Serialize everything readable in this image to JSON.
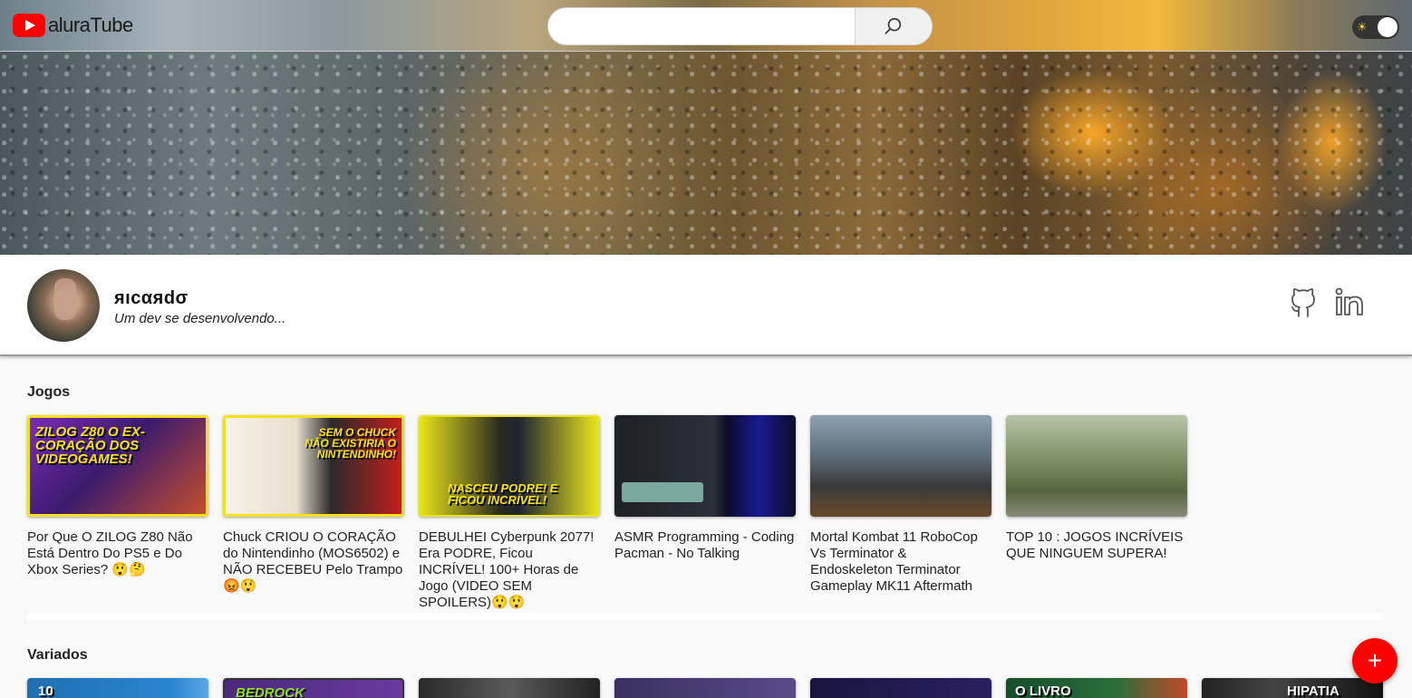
{
  "header": {
    "logo_text": "aluraTube",
    "search_placeholder": "",
    "search_value": ""
  },
  "profile": {
    "name": "яıcαяdσ",
    "bio": "Um dev se desenvolvendo..."
  },
  "sections": [
    {
      "title": "Jogos",
      "videos": [
        {
          "title": "Por Que O ZILOG Z80 Não Está Dentro Do PS5 e Do Xbox Series? 😲🤔",
          "thumb_text": "ZILOG Z80 O EX-CORAÇÃO DOS VIDEOGAMES!"
        },
        {
          "title": "Chuck CRIOU O CORAÇÃO do Nintendinho (MOS6502) e NÃO RECEBEU Pelo Trampo 😡😲",
          "thumb_text": "SEM O CHUCK NÃO EXISTIRIA O NINTENDINHO!"
        },
        {
          "title": "DEBULHEI Cyberpunk 2077! Era PODRE, Ficou INCRÍVEL! 100+ Horas de Jogo (VIDEO SEM SPOILERS)😲😲",
          "thumb_text": "NASCEU PODRE! E FICOU INCRÍVEL!"
        },
        {
          "title": "ASMR Programming - Coding Pacman - No Talking",
          "thumb_text": ""
        },
        {
          "title": "Mortal Kombat 11 RoboCop Vs Terminator & Endoskeleton Terminator Gameplay MK11 Aftermath",
          "thumb_text": ""
        },
        {
          "title": "TOP 10 : JOGOS INCRÍVEIS QUE NINGUEM SUPERA!",
          "thumb_text": ""
        }
      ]
    },
    {
      "title": "Variados",
      "videos": [
        {
          "thumb_text": "10"
        },
        {
          "thumb_text": "BEDROCK"
        },
        {
          "thumb_text": ""
        },
        {
          "thumb_text": ""
        },
        {
          "thumb_text": ""
        },
        {
          "thumb_text": "O LIVRO"
        },
        {
          "thumb_text": "HIPATIA"
        }
      ]
    }
  ],
  "fab_label": "+",
  "colors": {
    "brand_red": "#ff0000",
    "toggle_bg": "#333333"
  },
  "icons": {
    "search": "search-icon",
    "github": "github-icon",
    "linkedin": "linkedin-icon",
    "theme": "sun-icon"
  }
}
